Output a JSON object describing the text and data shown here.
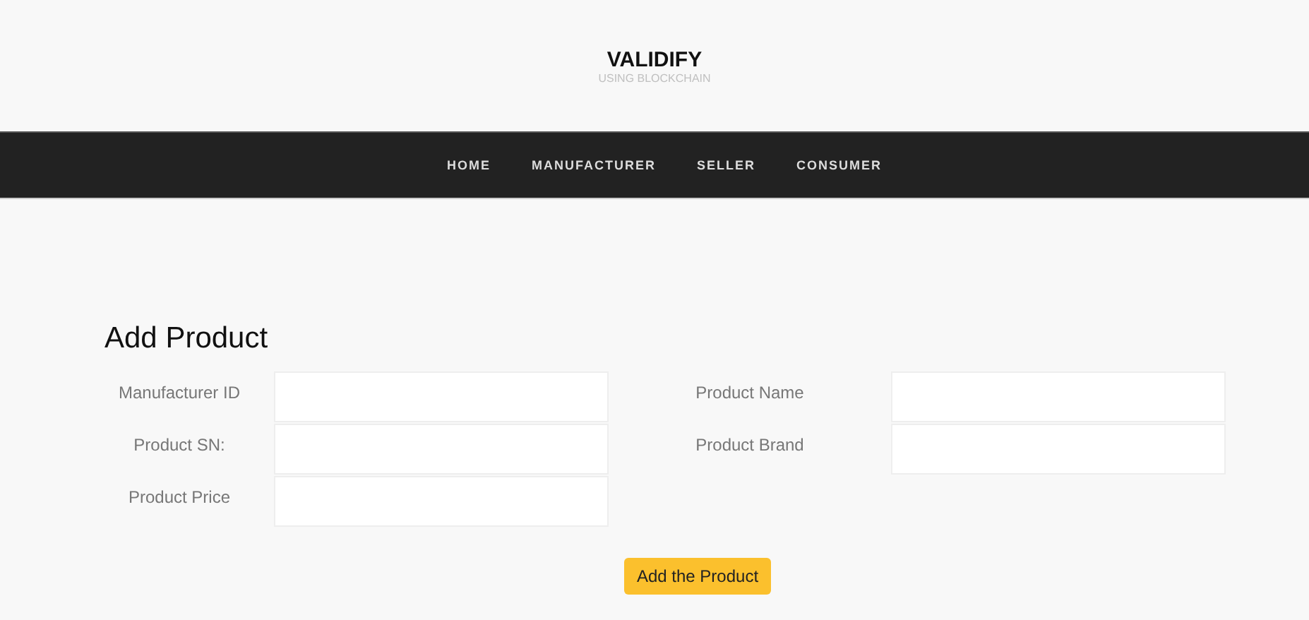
{
  "header": {
    "title": "VALIDIFY",
    "subtitle": "USING BLOCKCHAIN"
  },
  "nav": [
    "HOME",
    "MANUFACTURER",
    "SELLER",
    "CONSUMER"
  ],
  "form": {
    "title": "Add Product",
    "rows": [
      [
        {
          "label": "Manufacturer ID"
        },
        {
          "label": "Product Name"
        }
      ],
      [
        {
          "label": "Product SN:"
        },
        {
          "label": "Product Brand"
        }
      ],
      [
        {
          "label": "Product Price"
        }
      ]
    ],
    "submit": "Add the Product"
  }
}
